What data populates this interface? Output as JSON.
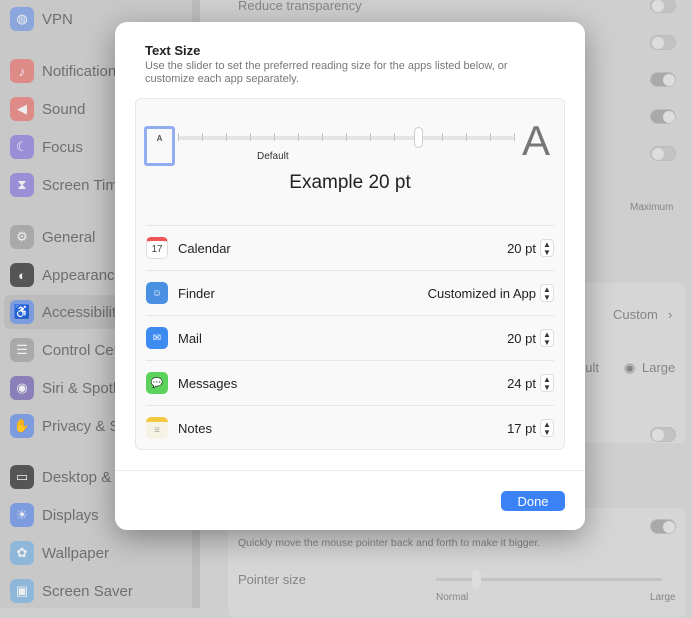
{
  "sidebar": {
    "items": [
      {
        "label": "VPN",
        "icon": "globe-icon",
        "color": "#8aa6dd",
        "glyph": "◍"
      },
      {
        "label": "Notifications",
        "icon": "bell-icon",
        "color": "#de8a87",
        "glyph": "♪"
      },
      {
        "label": "Sound",
        "icon": "speaker-icon",
        "color": "#de8a87",
        "glyph": "◀"
      },
      {
        "label": "Focus",
        "icon": "moon-icon",
        "color": "#9a8fd6",
        "glyph": "☾"
      },
      {
        "label": "Screen Time",
        "icon": "hourglass-icon",
        "color": "#9a8fd6",
        "glyph": "⧗"
      },
      {
        "label": "General",
        "icon": "gear-icon",
        "color": "#a9a9a9",
        "glyph": "⚙"
      },
      {
        "label": "Appearance",
        "icon": "appearance-icon",
        "color": "#555555",
        "glyph": "◐"
      },
      {
        "label": "Accessibility",
        "icon": "accessibility-icon",
        "color": "#7d9ce0",
        "glyph": "♿"
      },
      {
        "label": "Control Centre",
        "icon": "toggles-icon",
        "color": "#a9a9a9",
        "glyph": "☰"
      },
      {
        "label": "Siri & Spotlight",
        "icon": "siri-icon",
        "color": "#8a7fb8",
        "glyph": "◉"
      },
      {
        "label": "Privacy & Security",
        "icon": "hand-icon",
        "color": "#7d9ce0",
        "glyph": "✋"
      },
      {
        "label": "Desktop & Dock",
        "icon": "desktop-icon",
        "color": "#555555",
        "glyph": "▭"
      },
      {
        "label": "Displays",
        "icon": "sun-icon",
        "color": "#7d9ce0",
        "glyph": "☀"
      },
      {
        "label": "Wallpaper",
        "icon": "flower-icon",
        "color": "#8fb7d9",
        "glyph": "✿"
      },
      {
        "label": "Screen Saver",
        "icon": "screensaver-icon",
        "color": "#8fb7d9",
        "glyph": "▣"
      }
    ],
    "selected": 7
  },
  "background": {
    "reduce_transparency": "Reduce transparency",
    "toggles": [
      false,
      false,
      true,
      true,
      false
    ],
    "maximum": "Maximum",
    "custom": "Custom",
    "default_partial": "ault",
    "large_option": "Large",
    "shake_desc": "Quickly move the mouse pointer back and forth to make it bigger.",
    "pointer_size": "Pointer size",
    "normal": "Normal",
    "large": "Large"
  },
  "dialog": {
    "title": "Text Size",
    "description": "Use the slider to set the preferred reading size for the apps listed below, or customize each app separately.",
    "slider": {
      "small_label": "A",
      "large_label": "A",
      "default_label": "Default",
      "stops": 15,
      "value_index": 10,
      "default_index": 4
    },
    "example": "Example 20 pt",
    "apps": [
      {
        "name": "Calendar",
        "value": "20 pt",
        "icon": "calendar-icon",
        "glyph": "17"
      },
      {
        "name": "Finder",
        "value": "Customized in App",
        "icon": "finder-icon",
        "glyph": "☺"
      },
      {
        "name": "Mail",
        "value": "20 pt",
        "icon": "mail-icon",
        "glyph": "✉"
      },
      {
        "name": "Messages",
        "value": "24 pt",
        "icon": "messages-icon",
        "glyph": "💬"
      },
      {
        "name": "Notes",
        "value": "17 pt",
        "icon": "notes-icon",
        "glyph": "≡"
      }
    ],
    "done_label": "Done",
    "accent": "#3b82f6"
  }
}
